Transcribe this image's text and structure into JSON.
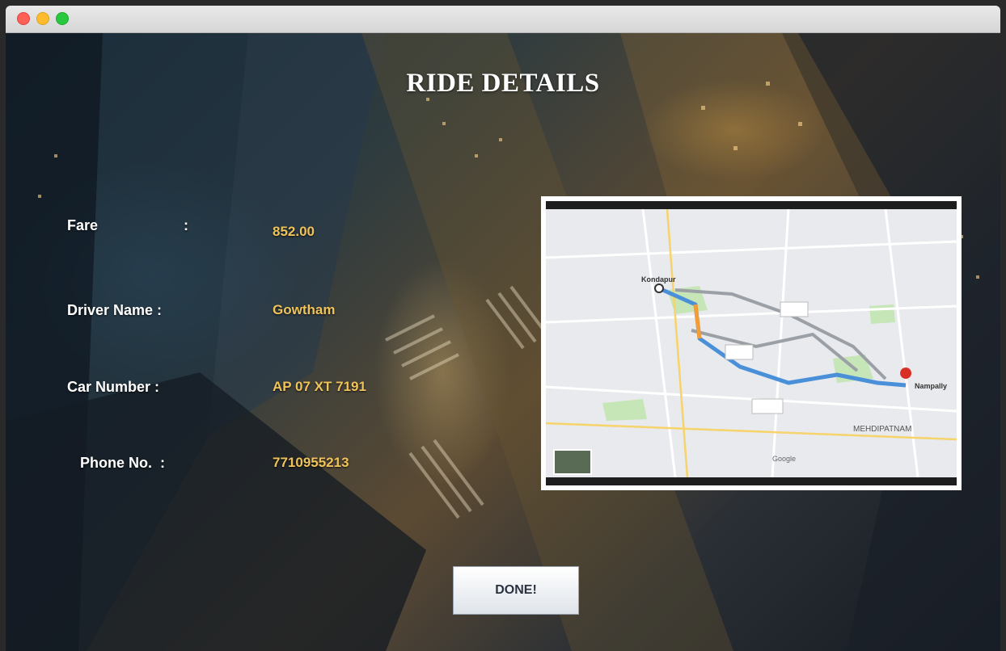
{
  "window": {
    "title": ""
  },
  "header": {
    "title": "RIDE DETAILS"
  },
  "details": [
    {
      "label": "Fare",
      "colon": ":",
      "value": "852.00"
    },
    {
      "label": "Driver Name :",
      "value": "Gowtham"
    },
    {
      "label": "Car Number :",
      "value": "AP 07 XT 7191"
    },
    {
      "label": "Phone No.  :",
      "value": "7710955213"
    }
  ],
  "map": {
    "start_label": "Kondapur",
    "end_label": "Nampally",
    "area_label": "MEHDIPATNAM",
    "brand": "Google"
  },
  "actions": {
    "done_label": "DONE!"
  },
  "colors": {
    "title_text": "#ffffff",
    "label_text": "#ffffff",
    "value_text": "#f0c35a",
    "route_primary": "#4a90d9",
    "route_alt": "#9aa0a6"
  }
}
